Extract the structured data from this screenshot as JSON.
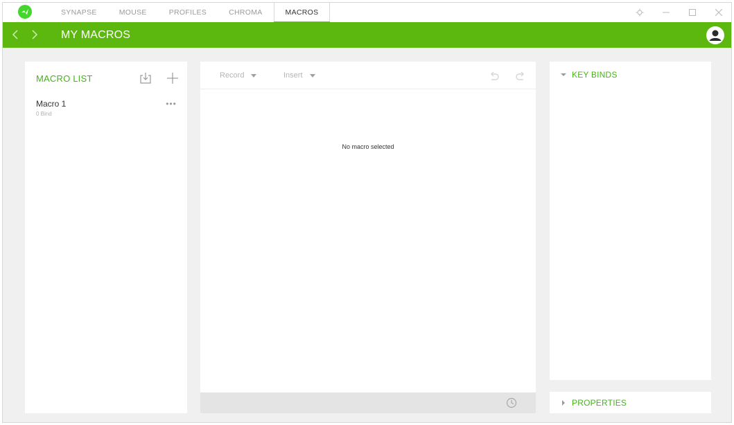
{
  "titlebar": {
    "tabs": [
      {
        "label": "SYNAPSE",
        "active": false
      },
      {
        "label": "MOUSE",
        "active": false
      },
      {
        "label": "PROFILES",
        "active": false
      },
      {
        "label": "CHROMA",
        "active": false
      },
      {
        "label": "MACROS",
        "active": true
      }
    ],
    "controls": [
      "settings-icon",
      "minimize-icon",
      "maximize-icon",
      "close-icon"
    ]
  },
  "header": {
    "title": "MY MACROS",
    "accent_color": "#5cb80f"
  },
  "macro_list": {
    "title": "MACRO LIST",
    "items": [
      {
        "name": "Macro 1",
        "subtitle": "0 Bind",
        "more": "•••"
      }
    ]
  },
  "editor": {
    "record_label": "Record",
    "insert_label": "Insert",
    "empty_message": "No macro selected"
  },
  "key_binds": {
    "title": "KEY BINDS",
    "expanded": true
  },
  "properties": {
    "title": "PROPERTIES",
    "expanded": false
  },
  "colors": {
    "brand_green": "#44d62c",
    "label_green": "#44b417",
    "background": "#f0f0f0"
  }
}
